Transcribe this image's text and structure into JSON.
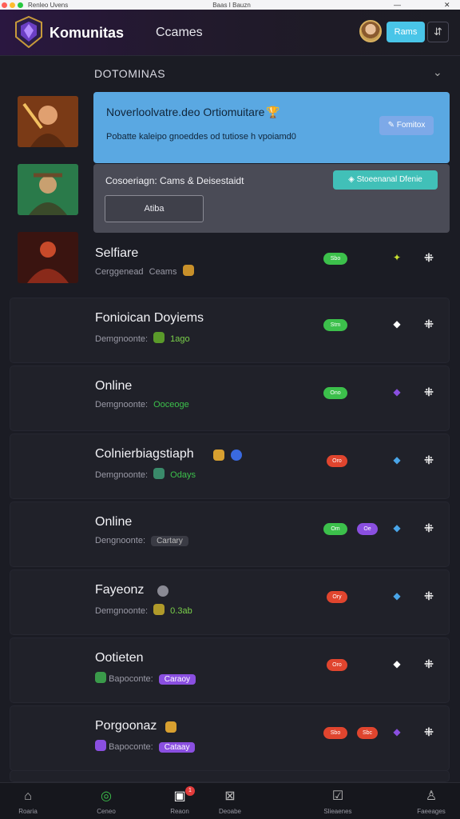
{
  "window": {
    "title_left": "Renleo Uvens",
    "title_center": "Baas I Bauzn",
    "minimize": "—",
    "close": "✕"
  },
  "colors": {
    "online": "#3cc04b",
    "offline": "#e0452e",
    "purple": "#8a4fe0",
    "accent_blue": "#49c5e8"
  },
  "header": {
    "brand": "Komunitas",
    "nav_games": "Ccames",
    "button": "Rams",
    "menu_icon": "⇵"
  },
  "section": {
    "label": "DOTOMINAS",
    "toggle_icon": "chevron-down-icon"
  },
  "banner_blue": {
    "title": "Noverloolvatre.deo Ortiomuitare",
    "text": "Pobatte kaleipo gnoeddes  od  tutiose h  vpoiamd0",
    "pill": "Fomitox"
  },
  "banner_grey": {
    "title": "Cosoeriagn: Cams & Deisestaidt",
    "teal_button": "Stoeenanal Dfenie",
    "auto_button": "Atiba"
  },
  "rows": [
    {
      "title": "Selfiare",
      "sub_label": "Cerggenead",
      "sub_value": "Ceams",
      "status": "Sbo",
      "status2": "",
      "action_icon": "sparkle-icon"
    },
    {
      "title": "Fonioican Doyiems",
      "sub_label": "Demgnoonte:",
      "sub_value": "1ago",
      "status": "Stm",
      "status2": "",
      "action_icon": "diamond-icon"
    },
    {
      "title": "Online",
      "sub_label": "Demgnoonte:",
      "sub_value": "Ooceoge",
      "status": "Ono",
      "status2": "",
      "action_icon": "diamond-icon"
    },
    {
      "title": "Colnierbiagstiaph",
      "sub_label": "Demgnoonte:",
      "sub_value": "Odays",
      "status": "Oro",
      "status2": "",
      "action_icon": "diamond-icon"
    },
    {
      "title": "Online",
      "sub_label": "Dengnoonte:",
      "sub_value": "Cartary",
      "status": "Om",
      "status2": "Oe",
      "action_icon": "diamond-icon"
    },
    {
      "title": "Fayeonz",
      "sub_label": "Demgnoonte:",
      "sub_value": "0.3ab",
      "status": "Ory",
      "status2": "",
      "action_icon": "diamond-icon"
    },
    {
      "title": "Ootieten",
      "sub_label": "Bapoconte:",
      "sub_value": "Caraoy",
      "status": "Oro",
      "status2": "",
      "action_icon": "diamond-icon"
    },
    {
      "title": "Porgoonaz",
      "sub_label": "Bapoconte:",
      "sub_value": "Cataay",
      "status": "Sbo",
      "status2": "Sbc",
      "action_icon": "diamond-icon"
    }
  ],
  "bottom_nav": [
    {
      "label": "Roaria",
      "icon": "home-icon"
    },
    {
      "label": "Ceneo",
      "icon": "compass-icon"
    },
    {
      "label": "Reaon",
      "icon": "library-icon",
      "badge": "1"
    },
    {
      "label": "Deoabe",
      "icon": "controller-icon"
    },
    {
      "label": "Slieaenes",
      "icon": "clipboard-icon"
    },
    {
      "label": "Faeeages",
      "icon": "profile-icon"
    }
  ]
}
